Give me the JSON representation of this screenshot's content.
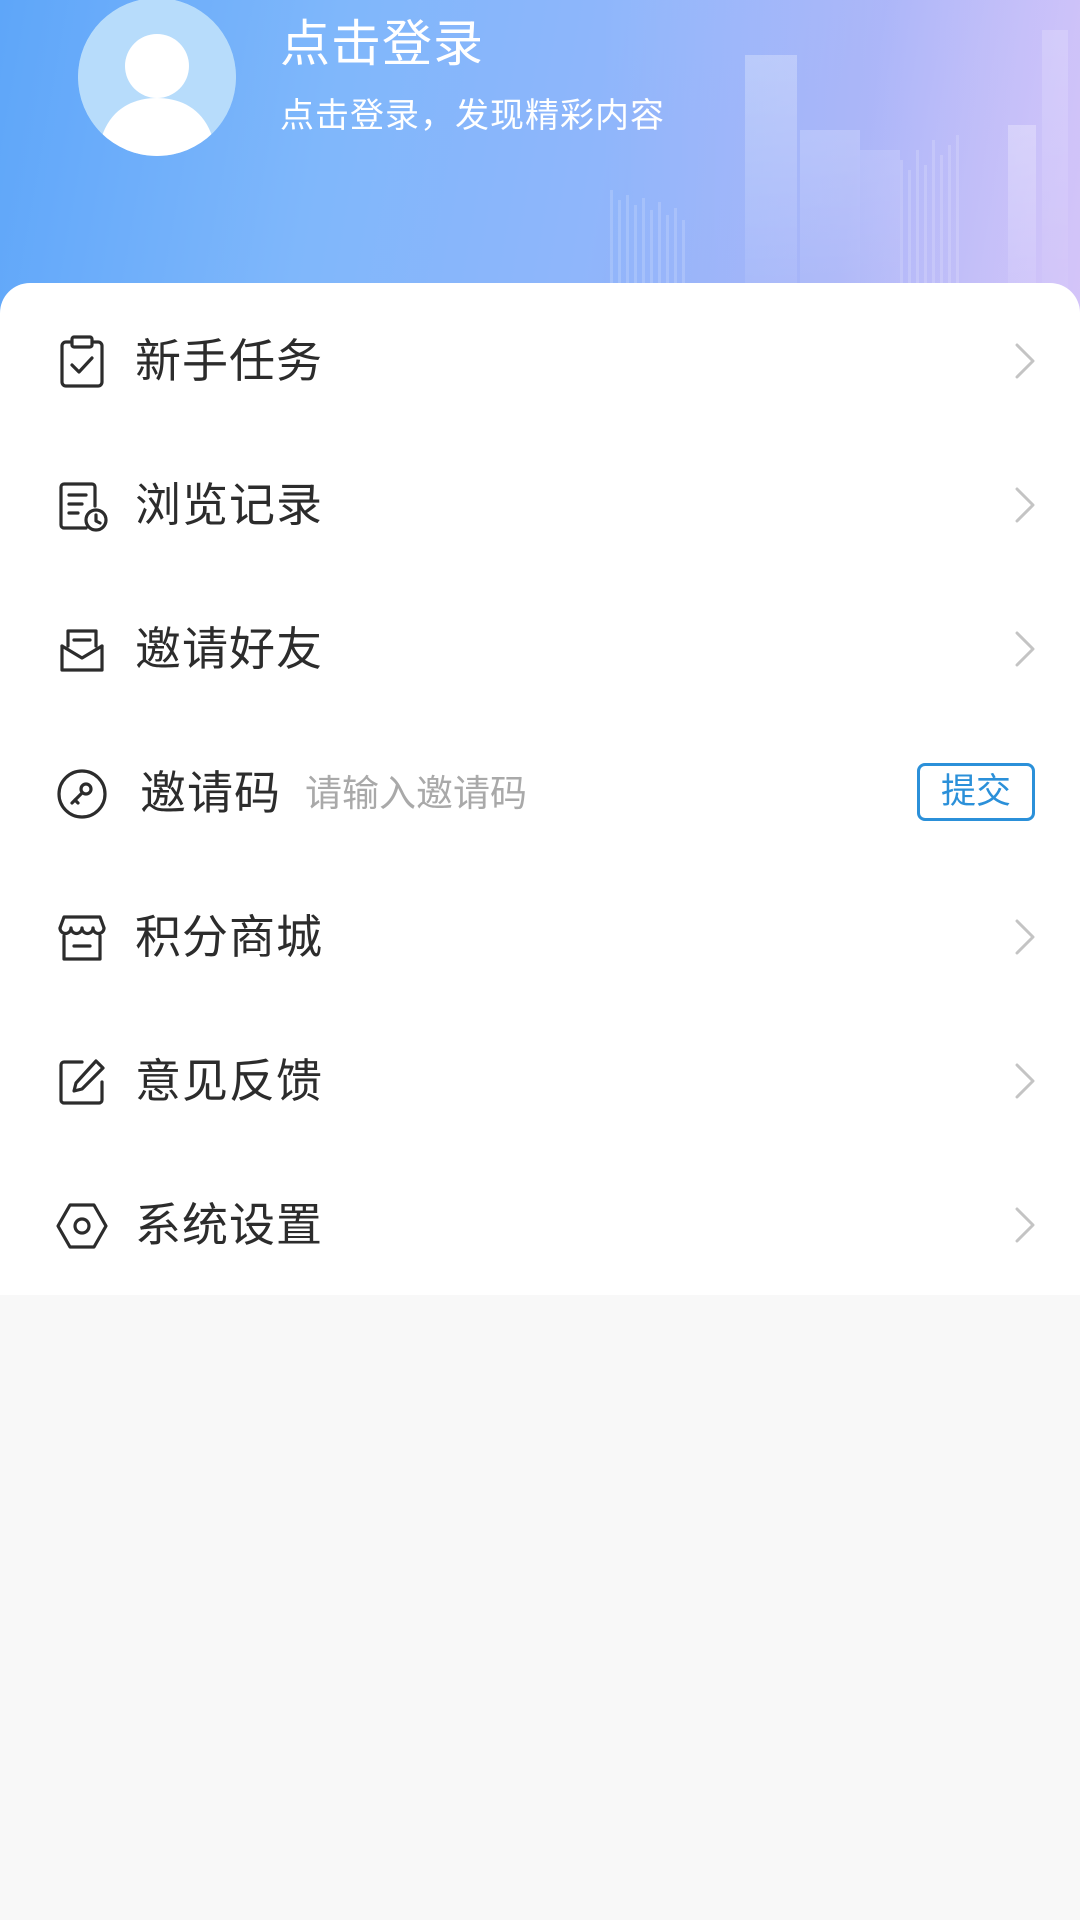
{
  "profile": {
    "title": "点击登录",
    "subtitle": "点击登录，发现精彩内容",
    "avatar_icon": "default-user-avatar-icon"
  },
  "menu": {
    "items": [
      {
        "key": "newbie-tasks",
        "label": "新手任务",
        "icon": "clipboard-check-icon"
      },
      {
        "key": "browse-history",
        "label": "浏览记录",
        "icon": "document-clock-icon"
      },
      {
        "key": "invite-friends",
        "label": "邀请好友",
        "icon": "envelope-icon"
      },
      {
        "key": "points-mall",
        "label": "积分商城",
        "icon": "storefront-icon"
      },
      {
        "key": "feedback",
        "label": "意见反馈",
        "icon": "edit-square-icon"
      },
      {
        "key": "settings",
        "label": "系统设置",
        "icon": "hexagon-gear-icon"
      }
    ],
    "invite_code": {
      "label": "邀请码",
      "placeholder": "请输入邀请码",
      "value": "",
      "submit_label": "提交",
      "icon": "key-circle-icon"
    }
  },
  "colors": {
    "header_start": "#5ea6f9",
    "header_end": "#c9b8f6",
    "accent": "#2b90d9",
    "text": "#2c2c2c",
    "placeholder": "#a9a9a9",
    "chevron": "#c4c4c4",
    "background": "#f8f8f8"
  }
}
